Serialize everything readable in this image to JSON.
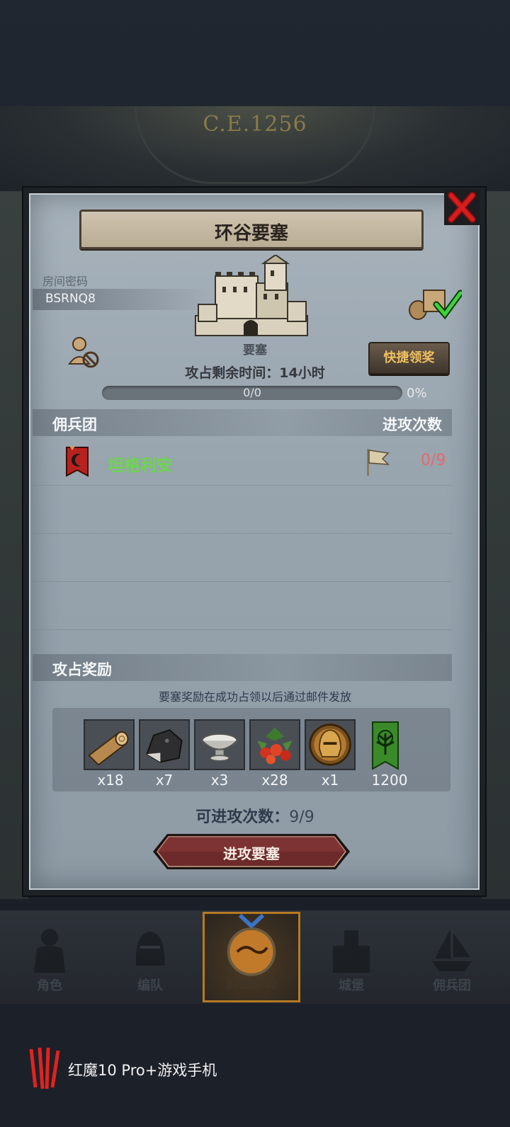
{
  "era": "C.E.1256",
  "dialog": {
    "title": "环谷要塞",
    "room_code_label": "房间密码",
    "room_code": "BSRNQ8",
    "fortress_label": "要塞",
    "timer_text": "攻占剩余时间：14小时",
    "progress_text": "0/0",
    "progress_percent": "0%",
    "progress_fraction": 0,
    "quick_claim_label": "快捷领奖",
    "mercenary_header": "佣兵团",
    "attacks_header": "进攻次数",
    "mercenaries": [
      {
        "name": "坦格利安",
        "attacks": "0/9"
      }
    ],
    "rewards_header": "攻占奖励",
    "rewards_note": "要塞奖励在成功占领以后通过邮件发放",
    "rewards": [
      {
        "icon": "wood-log-icon",
        "qty": "x18"
      },
      {
        "icon": "ore-stone-icon",
        "qty": "x7"
      },
      {
        "icon": "silver-bowl-icon",
        "qty": "x3"
      },
      {
        "icon": "berries-icon",
        "qty": "x28"
      },
      {
        "icon": "helmet-coin-icon",
        "qty": "x1"
      },
      {
        "icon": "tree-banner-icon",
        "qty": "1200"
      }
    ],
    "remaining_label": "可进攻次数：",
    "remaining_value": "9/9",
    "attack_button": "进攻要塞"
  },
  "nav": [
    {
      "label": "角色",
      "icon": "knight-icon"
    },
    {
      "label": "编队",
      "icon": "helmet-icon"
    },
    {
      "label": "前往群岛",
      "icon": "island-globe-icon"
    },
    {
      "label": "城堡",
      "icon": "castle-icon"
    },
    {
      "label": "佣兵团",
      "icon": "ship-icon"
    }
  ],
  "brand_text": "红魔10 Pro+游戏手机",
  "colors": {
    "accent_gold": "#f0c060",
    "merc_green": "#6bd64a",
    "attacks_red": "#e46a6a"
  }
}
